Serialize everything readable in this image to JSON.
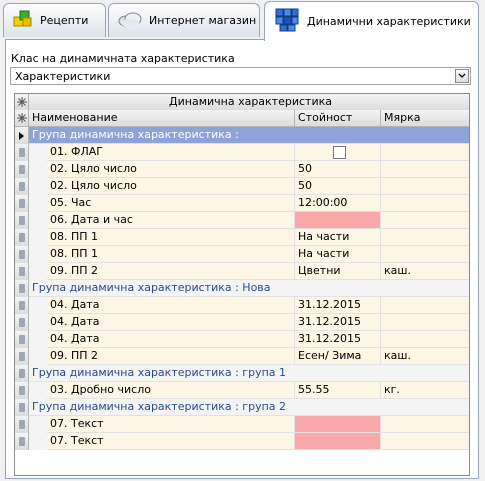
{
  "tabs": [
    {
      "label": "Рецепти",
      "icon": "recipes-cubes-icon"
    },
    {
      "label": "Интернет магазин",
      "icon": "cloud-icon"
    },
    {
      "label": "Динамични характеристики",
      "icon": "blue-cubes-icon",
      "active": true
    }
  ],
  "class_field": {
    "label": "Клас на динамичната характеристика",
    "value": "Характеристики"
  },
  "grid": {
    "band_header": "Динамична характеристика",
    "columns": {
      "name": "Наименование",
      "value": "Стойност",
      "unit": "Мярка"
    },
    "rows": [
      {
        "type": "group",
        "text": "Група динамична характеристика :",
        "selected": true
      },
      {
        "type": "item",
        "name": "01. ФЛАГ",
        "value": "",
        "unit": "",
        "checkbox": true
      },
      {
        "type": "item",
        "name": "02. Цяло число",
        "value": "50",
        "unit": ""
      },
      {
        "type": "item",
        "name": "02. Цяло число",
        "value": "50",
        "unit": ""
      },
      {
        "type": "item",
        "name": "05. Час",
        "value": "12:00:00",
        "unit": ""
      },
      {
        "type": "item",
        "name": "06. Дата и час",
        "value": "",
        "unit": "",
        "highlight": true
      },
      {
        "type": "item",
        "name": "08. ПП 1",
        "value": "На части",
        "unit": ""
      },
      {
        "type": "item",
        "name": "08. ПП 1",
        "value": "На части",
        "unit": ""
      },
      {
        "type": "item",
        "name": "09. ПП 2",
        "value": "Цветни",
        "unit": "каш."
      },
      {
        "type": "group",
        "text": "Група динамична характеристика : Нова"
      },
      {
        "type": "item",
        "name": "04. Дата",
        "value": "31.12.2015",
        "unit": ""
      },
      {
        "type": "item",
        "name": "04. Дата",
        "value": "31.12.2015",
        "unit": ""
      },
      {
        "type": "item",
        "name": "04. Дата",
        "value": "31.12.2015",
        "unit": ""
      },
      {
        "type": "item",
        "name": "09. ПП 2",
        "value": "Есен/ Зима",
        "unit": "каш."
      },
      {
        "type": "group",
        "text": "Група динамична характеристика : група 1"
      },
      {
        "type": "item",
        "name": "03. Дробно число",
        "value": "55.55",
        "unit": "кг."
      },
      {
        "type": "group",
        "text": "Група динамична характеристика : група 2"
      },
      {
        "type": "item",
        "name": "07. Текст",
        "value": "",
        "unit": "",
        "highlight": true
      },
      {
        "type": "item",
        "name": "07. Текст",
        "value": "",
        "unit": "",
        "highlight": true
      }
    ]
  },
  "colors": {
    "group_selected": "#8ea3d9",
    "item_bg": "#fdf6e4",
    "highlight": "#f9a9a9"
  }
}
